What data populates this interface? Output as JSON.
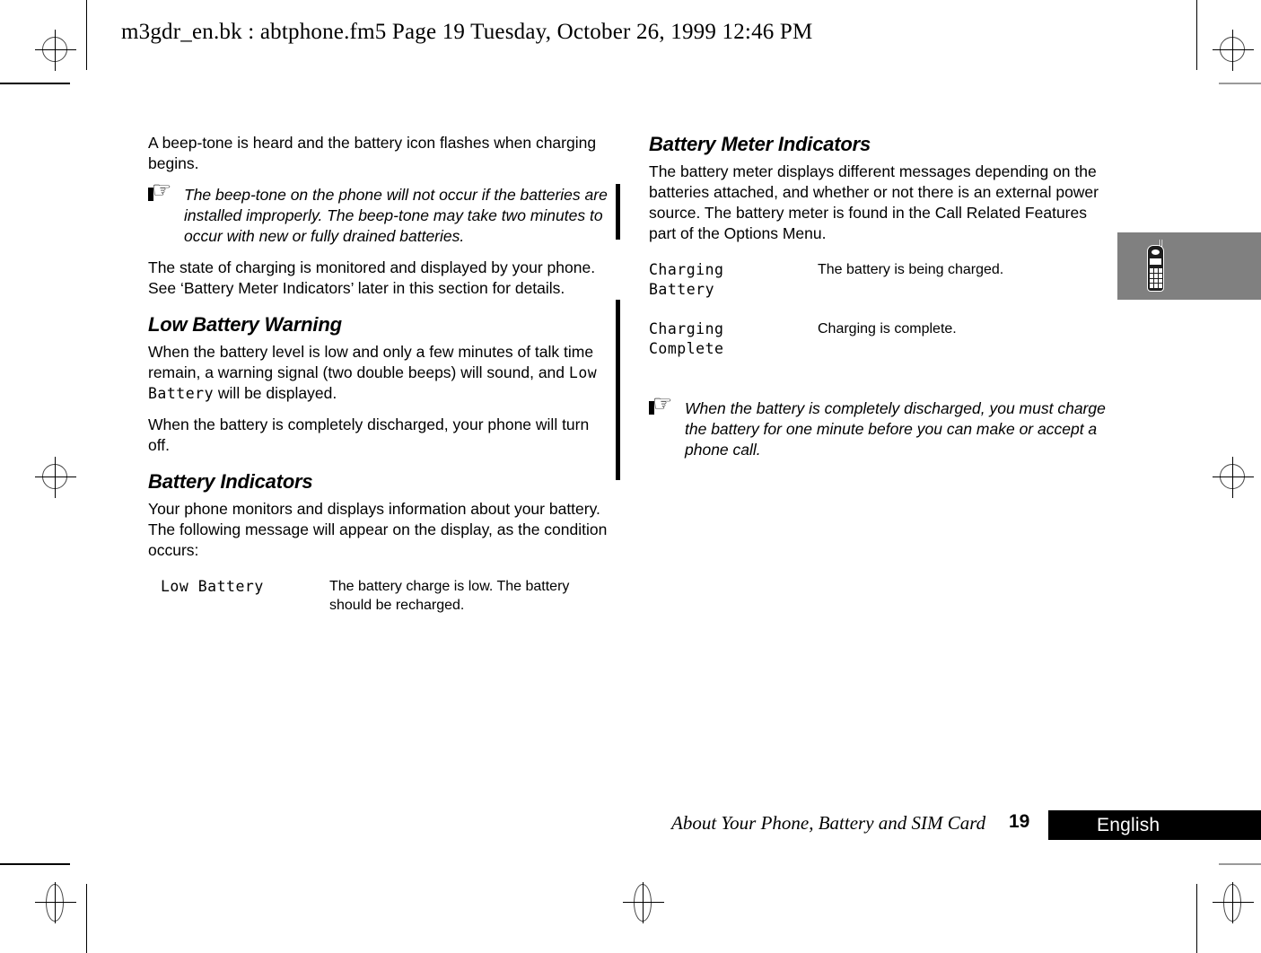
{
  "header": {
    "running_head": "m3gdr_en.bk : abtphone.fm5  Page 19  Tuesday, October 26, 1999  12:46 PM"
  },
  "left_column": {
    "intro_paragraph": "A beep-tone is heard and the battery icon flashes when charging begins.",
    "note_1": "The beep-tone on the phone will not occur if the batteries are installed improperly. The beep-tone may take two minutes to occur with new or fully drained batteries.",
    "state_paragraph": "The state of charging is monitored and displayed by your phone. See ‘Battery Meter Indicators’ later in this section for details.",
    "section_low_battery_warning": {
      "heading": "Low Battery Warning",
      "paragraph_1_part_1": "When the battery level is low and only a few minutes of talk time remain, a warning signal (two double beeps) will sound, and ",
      "paragraph_1_lcd_1": "Low",
      "paragraph_1_lcd_2": "Battery",
      "paragraph_1_part_2": " will be displayed.",
      "paragraph_2": "When the battery is completely discharged, your phone will turn off."
    },
    "section_battery_indicators": {
      "heading": "Battery Indicators",
      "paragraph": "Your phone monitors and displays information about your battery. The following message will appear on the display, as the condition occurs:",
      "messages": [
        {
          "display_line_1": "Low Battery",
          "description": "The battery charge is low. The battery should be recharged."
        }
      ]
    }
  },
  "right_column": {
    "section_battery_meter_indicators": {
      "heading": "Battery Meter Indicators",
      "paragraph": "The battery meter displays different messages depending on the batteries attached, and whether or not there is an external power source. The battery meter is found in the Call Related Features part of the Options Menu.",
      "messages": [
        {
          "display_line_1": "Charging",
          "display_line_2": "Battery",
          "description": "The battery is being charged."
        },
        {
          "display_line_1": "Charging",
          "display_line_2": "Complete",
          "description": "Charging is complete."
        }
      ],
      "note": "When the battery is completely discharged, you must charge the battery for one minute before you can make or accept a phone call."
    }
  },
  "thumb_tab": {
    "icon": "mobile-phone-icon",
    "background_color": "#808080"
  },
  "footer": {
    "chapter_title": "About Your Phone, Battery and SIM Card",
    "page_number": "19",
    "language": "English"
  },
  "icons": {
    "pointing_hand": "☞"
  }
}
